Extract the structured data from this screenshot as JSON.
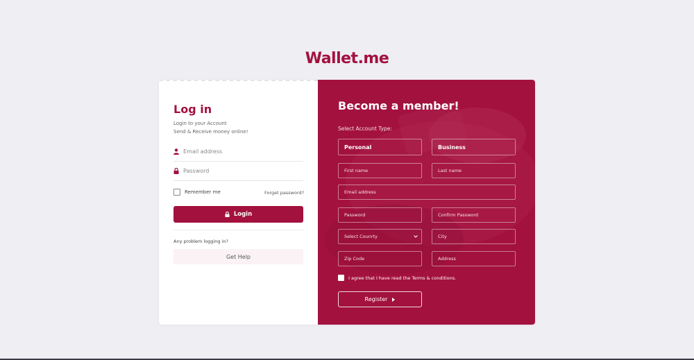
{
  "brand": "Wallet.me",
  "login": {
    "title": "Log in",
    "subtitle_line1": "Login to your Account",
    "subtitle_line2": "Send & Receive money online!",
    "email_placeholder": "Email address",
    "password_placeholder": "Password",
    "remember_label": "Remember me",
    "forgot_label": "Forget password?",
    "login_label": "Login",
    "problem_text": "Any problem logging in?",
    "help_label": "Get Help"
  },
  "register": {
    "title": "Become a member!",
    "account_type_label": "Select Account Type:",
    "account_types": [
      "Personal",
      "Business"
    ],
    "first_name": "First name",
    "last_name": "Last name",
    "email": "Email address",
    "password": "Password",
    "confirm_password": "Confirm Password",
    "country": "Select Counrty",
    "city": "City",
    "zip": "Zip Code",
    "address": "Address",
    "agree_text": "I agree that I have read the Terms & conditions.",
    "register_label": "Register"
  },
  "colors": {
    "accent": "#a3113f",
    "background": "#eeeef3"
  }
}
